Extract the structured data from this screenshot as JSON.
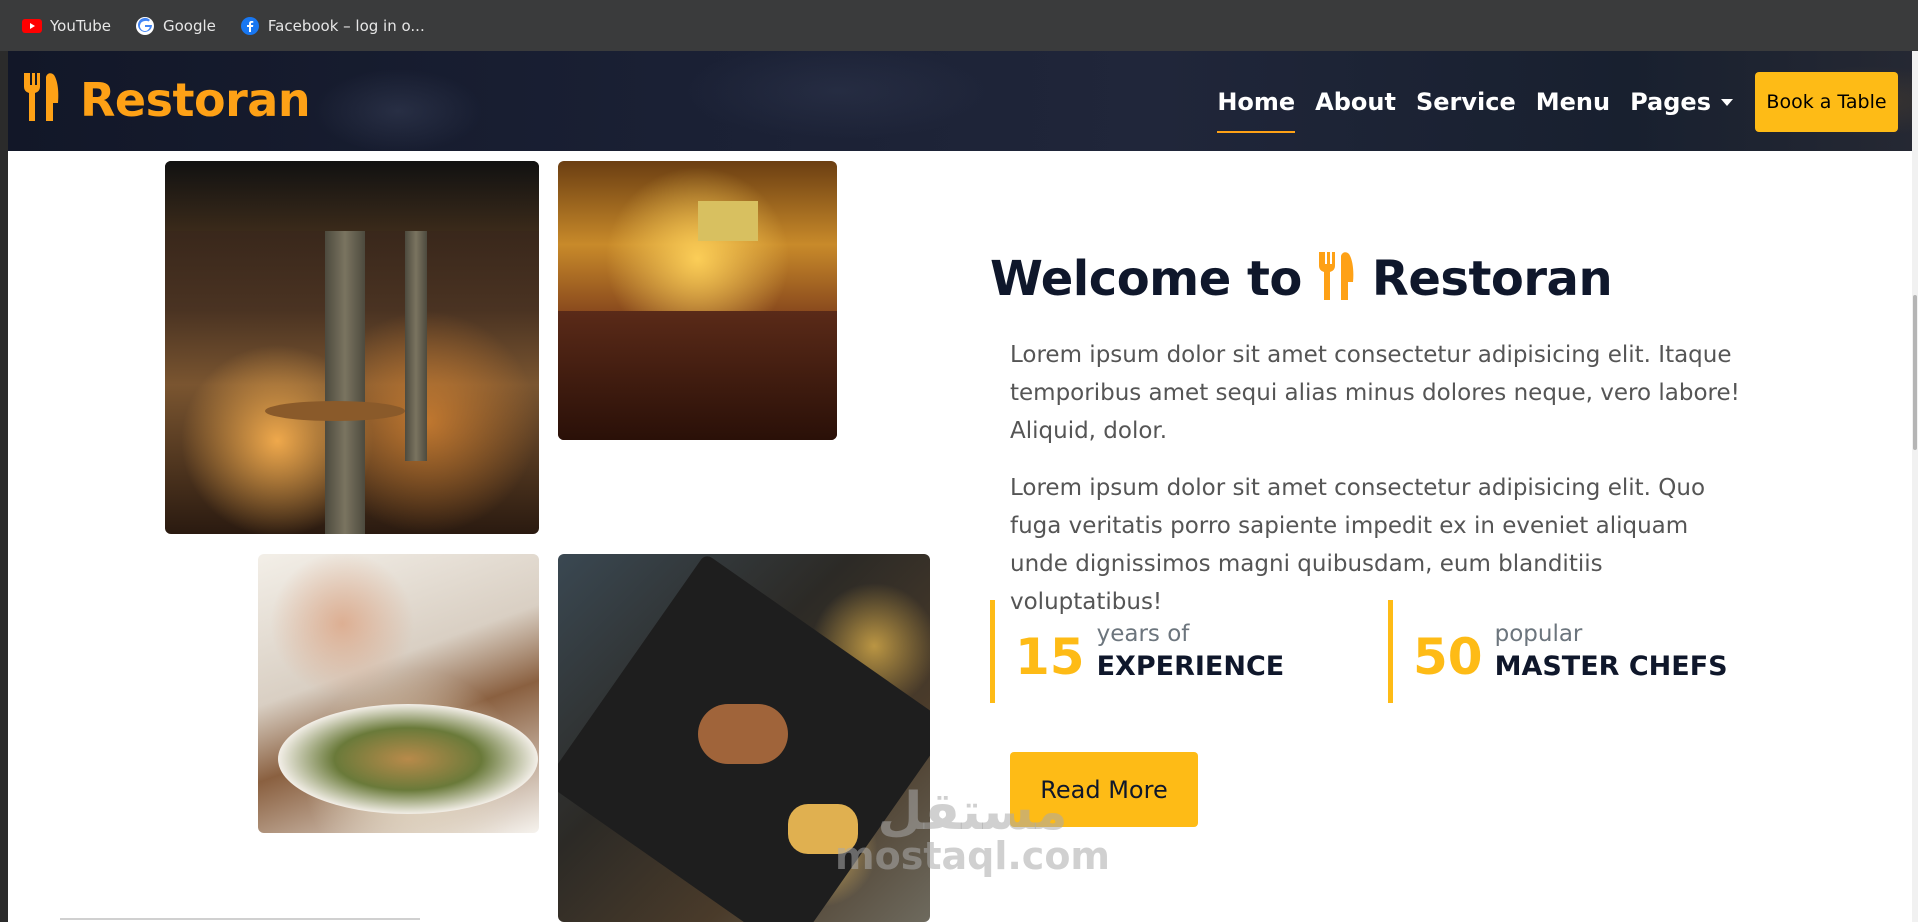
{
  "bookmarks": [
    {
      "label": "YouTube",
      "icon": "youtube-icon"
    },
    {
      "label": "Google",
      "icon": "google-icon"
    },
    {
      "label": "Facebook – log in o...",
      "icon": "facebook-icon"
    }
  ],
  "navbar": {
    "brand": "Restoran",
    "links": [
      "Home",
      "About",
      "Service",
      "Menu",
      "Pages"
    ],
    "active": "Home",
    "cta": "Book a Table"
  },
  "about": {
    "welcome_prefix": "Welcome to",
    "welcome_brand": "Restoran",
    "paragraphs": [
      "Lorem ipsum dolor sit amet consectetur adipisicing elit. Itaque temporibus amet sequi alias minus dolores neque, vero labore! Aliquid, dolor.",
      "Lorem ipsum dolor sit amet consectetur adipisicing elit. Quo fuga veritatis porro sapiente impedit ex in eveniet aliquam unde dignissimos magni quibusdam, eum blanditiis voluptatibus!"
    ],
    "stats": [
      {
        "number": "15",
        "small": "years of",
        "big": "EXPERIENCE"
      },
      {
        "number": "50",
        "small": "popular",
        "big": "MASTER CHEFS"
      }
    ],
    "read_more": "Read More"
  },
  "watermark": {
    "arabic": "مستقل",
    "latin": "mostaql.com"
  },
  "colors": {
    "primary": "#FEA116",
    "button": "#FEBB16",
    "dark": "#0F172B"
  }
}
